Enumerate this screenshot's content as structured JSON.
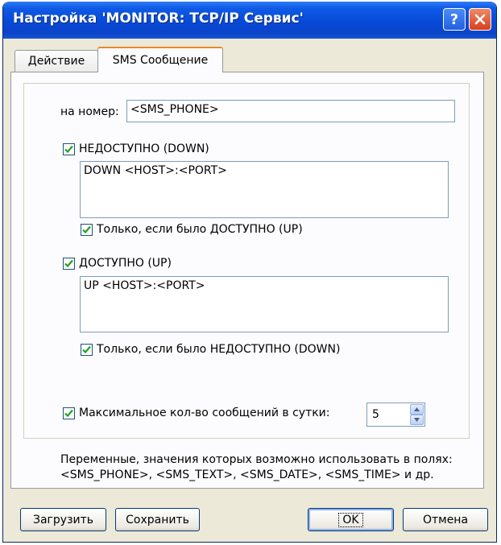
{
  "window": {
    "title": "Настройка 'MONITOR: TCP/IP Сервис'",
    "help_glyph": "?",
    "colors": {
      "titlebar": "#0849d8",
      "face": "#ece9d8",
      "checkmark": "#21a121"
    }
  },
  "tabs": [
    {
      "label": "Действие",
      "selected": false
    },
    {
      "label": "SMS Сообщение",
      "selected": true
    }
  ],
  "phone": {
    "label": "на номер:",
    "value": "<SMS_PHONE>"
  },
  "down": {
    "label": "НЕДОСТУПНО (DOWN)",
    "checked": true,
    "text": "DOWN <HOST>:<PORT>",
    "only_if": {
      "label": "Только, если было ДОСТУПНО (UP)",
      "checked": true
    }
  },
  "up": {
    "label": "ДОСТУПНО (UP)",
    "checked": true,
    "text": "UP <HOST>:<PORT>",
    "only_if": {
      "label": "Только, если было НЕДОСТУПНО (DOWN)",
      "checked": true
    }
  },
  "max_messages": {
    "label": "Максимальное кол-во сообщений в сутки:",
    "checked": true,
    "value": "5"
  },
  "note": {
    "line1": "Переменные, значения которых возможно использовать в полях:",
    "line2": "<SMS_PHONE>, <SMS_TEXT>, <SMS_DATE>, <SMS_TIME> и др."
  },
  "buttons": {
    "load": "Загрузить",
    "save": "Сохранить",
    "ok": "OK",
    "cancel": "Отмена"
  }
}
